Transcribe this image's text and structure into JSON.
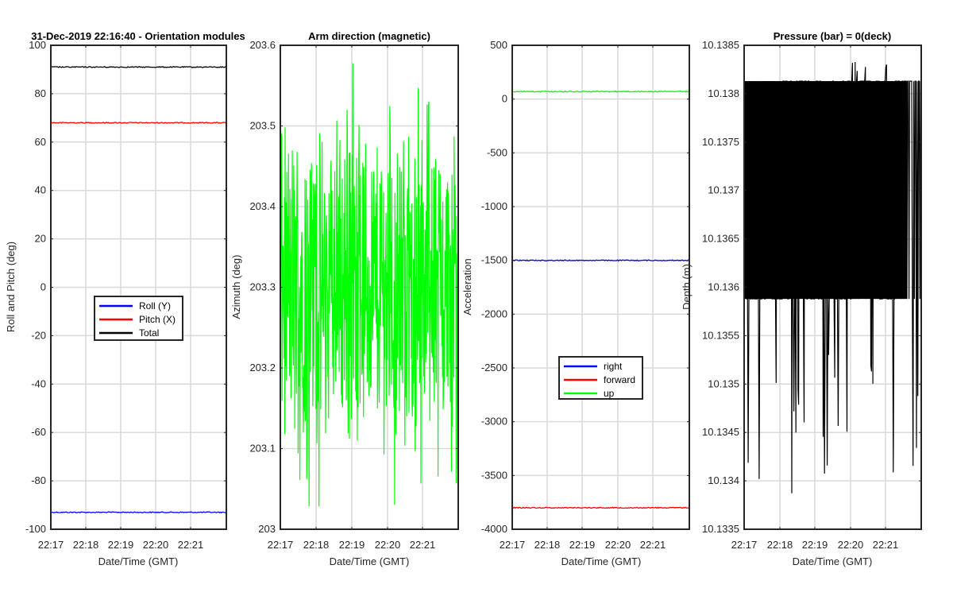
{
  "chart_data": [
    {
      "type": "line",
      "title": "31-Dec-2019 22:16:40 - Orientation modules",
      "xlabel": "Date/Time (GMT)",
      "ylabel": "Roll and Pitch (deg)",
      "xlim": [
        "22:16.9",
        "22:21.9"
      ],
      "x_ticks": [
        "22:17",
        "22:18",
        "22:19",
        "22:20",
        "22:21"
      ],
      "ylim": [
        -100,
        100
      ],
      "y_ticks": [
        "-100",
        "-80",
        "-60",
        "-40",
        "-20",
        "0",
        "20",
        "40",
        "60",
        "80",
        "100"
      ],
      "grid": true,
      "legend_position": "center",
      "series": [
        {
          "name": "Roll (Y)",
          "color": "#0000ff",
          "value": -93
        },
        {
          "name": "Pitch (X)",
          "color": "#ff0000",
          "value": 68
        },
        {
          "name": "Total",
          "color": "#000000",
          "value": 91
        }
      ]
    },
    {
      "type": "line",
      "title": "Arm direction (magnetic)",
      "xlabel": "Date/Time (GMT)",
      "ylabel": "Azimuth (deg)",
      "x_ticks": [
        "22:17",
        "22:18",
        "22:19",
        "22:20",
        "22:21"
      ],
      "ylim": [
        203,
        203.6
      ],
      "y_ticks": [
        "203",
        "203.1",
        "203.2",
        "203.3",
        "203.4",
        "203.5",
        "203.6"
      ],
      "grid": true,
      "series": [
        {
          "color": "#00ff00",
          "mean": 203.3,
          "spread": [
            203.01,
            203.58
          ]
        }
      ]
    },
    {
      "type": "line",
      "title": "",
      "xlabel": "Date/Time (GMT)",
      "ylabel": "Acceleration",
      "x_ticks": [
        "22:17",
        "22:18",
        "22:19",
        "22:20",
        "22:21"
      ],
      "ylim": [
        -4000,
        500
      ],
      "y_ticks": [
        "-4000",
        "-3500",
        "-3000",
        "-2500",
        "-2000",
        "-1500",
        "-1000",
        "-500",
        "0",
        "500"
      ],
      "grid": true,
      "legend_position": "lower-center",
      "series": [
        {
          "name": "right",
          "color": "#0000ff",
          "value": -1500
        },
        {
          "name": "forward",
          "color": "#ff0000",
          "value": -3800
        },
        {
          "name": "up",
          "color": "#00ff00",
          "value": 70
        }
      ]
    },
    {
      "type": "line",
      "title": "Pressure (bar) = 0(deck)",
      "xlabel": "Date/Time (GMT)",
      "ylabel": "Depth (m)",
      "x_ticks": [
        "22:17",
        "22:18",
        "22:19",
        "22:20",
        "22:21"
      ],
      "ylim": [
        10.1335,
        10.1385
      ],
      "y_ticks": [
        "10.1335",
        "10.134",
        "10.1345",
        "10.135",
        "10.1355",
        "10.136",
        "10.1365",
        "10.137",
        "10.1375",
        "10.138",
        "10.1385"
      ],
      "grid": true,
      "series": [
        {
          "color": "#000000",
          "band": [
            10.13588,
            10.13813
          ],
          "min": 10.13384,
          "max": 10.13833
        }
      ]
    }
  ]
}
